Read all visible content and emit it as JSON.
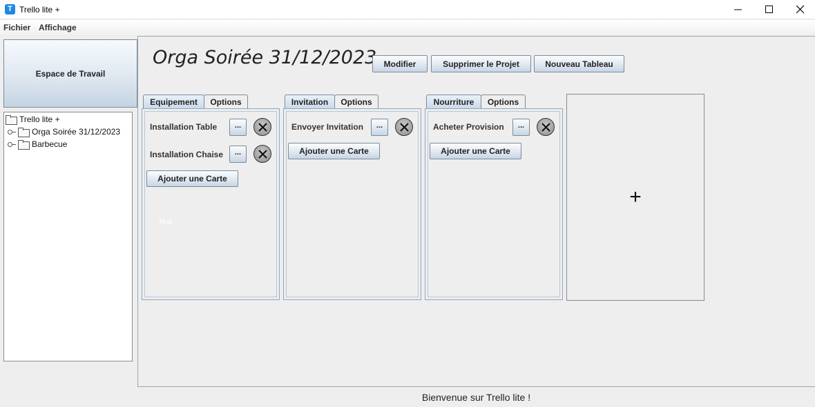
{
  "window": {
    "icon_letter": "T",
    "title": "Trello lite +"
  },
  "menu": [
    "Fichier",
    "Affichage"
  ],
  "sidebar": {
    "workspace_button": "Espace de Travail",
    "tree": {
      "root": "Trello lite +",
      "children": [
        "Orga Soirée 31/12/2023",
        "Barbecue"
      ]
    }
  },
  "project": {
    "title": "Orga Soirée 31/12/2023",
    "actions": {
      "edit": "Modifier",
      "delete": "Supprimer le Projet",
      "new_board": "Nouveau Tableau"
    }
  },
  "boards": [
    {
      "tab": "Equipement",
      "options_tab": "Options",
      "cards": [
        {
          "label": "Installation Table",
          "more": "..."
        },
        {
          "label": "Installation Chaise",
          "more": "..."
        }
      ],
      "add_card": "Ajouter une Carte",
      "placeholder": "Text"
    },
    {
      "tab": "Invitation",
      "options_tab": "Options",
      "cards": [
        {
          "label": "Envoyer Invitation",
          "more": "..."
        }
      ],
      "add_card": "Ajouter une Carte"
    },
    {
      "tab": "Nourriture",
      "options_tab": "Options",
      "cards": [
        {
          "label": "Acheter Provision",
          "more": "..."
        }
      ],
      "add_card": "Ajouter une Carte"
    }
  ],
  "add_board": {
    "symbol": "+",
    "icon": "plus-icon"
  },
  "status": "Bienvenue sur Trello lite !"
}
